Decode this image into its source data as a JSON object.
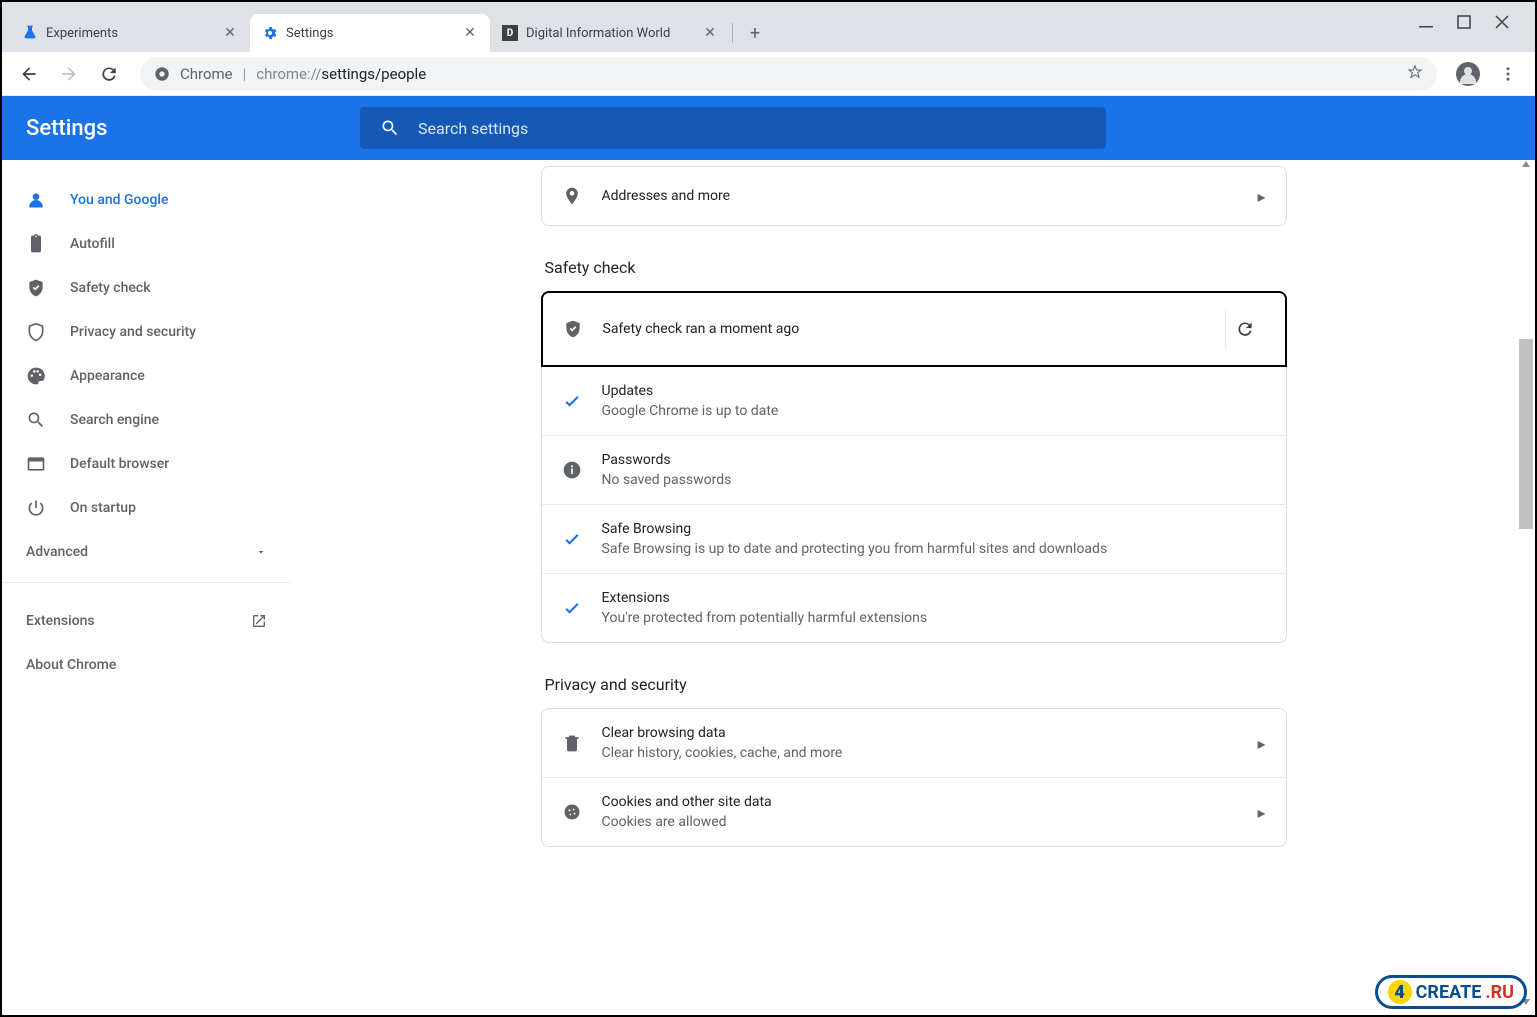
{
  "window": {
    "minimize_tip": "Minimize",
    "maximize_tip": "Maximize",
    "close_tip": "Close"
  },
  "tabs": [
    {
      "label": "Experiments",
      "favicon": "flask-icon",
      "active": false
    },
    {
      "label": "Settings",
      "favicon": "gear-icon",
      "active": true
    },
    {
      "label": "Digital Information World",
      "favicon": "diw-icon",
      "active": false
    }
  ],
  "omnibox": {
    "security_label": "Chrome",
    "url_prefix": "chrome://",
    "url_path": "settings/people"
  },
  "settings_header": {
    "title": "Settings",
    "search_placeholder": "Search settings"
  },
  "sidebar": {
    "items": [
      {
        "label": "You and Google",
        "icon": "person-icon"
      },
      {
        "label": "Autofill",
        "icon": "clipboard-icon"
      },
      {
        "label": "Safety check",
        "icon": "shield-check-icon"
      },
      {
        "label": "Privacy and security",
        "icon": "shield-icon"
      },
      {
        "label": "Appearance",
        "icon": "palette-icon"
      },
      {
        "label": "Search engine",
        "icon": "search-icon"
      },
      {
        "label": "Default browser",
        "icon": "browser-icon"
      },
      {
        "label": "On startup",
        "icon": "power-icon"
      }
    ],
    "advanced": "Advanced",
    "extensions": "Extensions",
    "about": "About Chrome"
  },
  "main": {
    "addresses": {
      "label": "Addresses and more"
    },
    "safety_heading": "Safety check",
    "safety_status": "Safety check ran a moment ago",
    "safety_items": [
      {
        "title": "Updates",
        "sub": "Google Chrome is up to date",
        "icon": "check"
      },
      {
        "title": "Passwords",
        "sub": "No saved passwords",
        "icon": "info"
      },
      {
        "title": "Safe Browsing",
        "sub": "Safe Browsing is up to date and protecting you from harmful sites and downloads",
        "icon": "check"
      },
      {
        "title": "Extensions",
        "sub": "You're protected from potentially harmful extensions",
        "icon": "check"
      }
    ],
    "privacy_heading": "Privacy and security",
    "privacy_items": [
      {
        "title": "Clear browsing data",
        "sub": "Clear history, cookies, cache, and more",
        "icon": "trash"
      },
      {
        "title": "Cookies and other site data",
        "sub": "Cookies are allowed",
        "icon": "cookie"
      }
    ]
  },
  "watermark": {
    "brand": "CREATE",
    "suffix": ".RU"
  }
}
